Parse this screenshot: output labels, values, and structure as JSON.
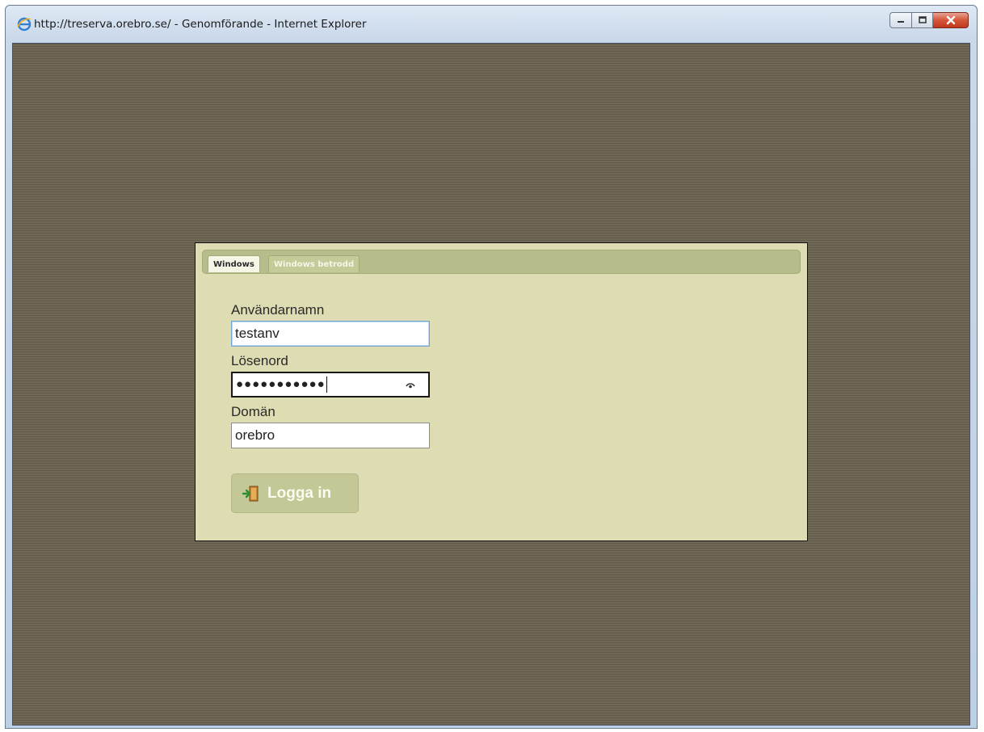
{
  "window": {
    "title": "http://treserva.orebro.se/ - Genomförande - Internet Explorer",
    "icon": "internet-explorer-icon",
    "controls": {
      "minimize": "minimize-icon",
      "maximize": "maximize-icon",
      "close": "close-icon"
    }
  },
  "login": {
    "tabs": [
      {
        "label": "Windows",
        "active": true
      },
      {
        "label": "Windows betrodd",
        "active": false
      }
    ],
    "username": {
      "label": "Användarnamn",
      "value": "testanv"
    },
    "password": {
      "label": "Lösenord",
      "value": "●●●●●●●●●●●",
      "reveal_icon": "eye-icon"
    },
    "domain": {
      "label": "Domän",
      "value": "orebro"
    },
    "submit": {
      "label": "Logga in",
      "icon": "exit-door-icon"
    }
  },
  "colors": {
    "background": "#6b6452",
    "panel": "#dedcb2",
    "tabbar": "#b7bd8a",
    "button": "#c4c796",
    "close_button": "#c1371c"
  }
}
